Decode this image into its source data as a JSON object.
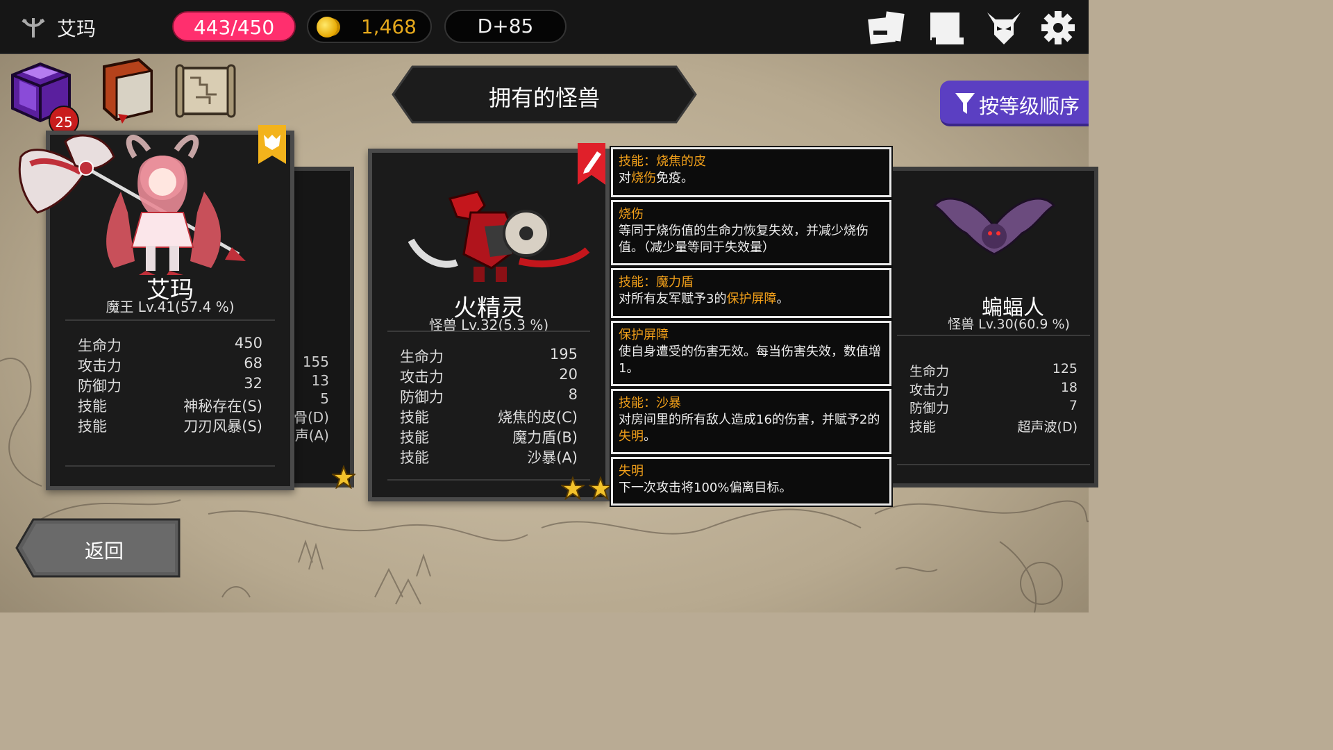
{
  "player": {
    "name": "艾玛",
    "hp": "443/450",
    "gold": "1,468",
    "day": "D+85"
  },
  "top_icons": [
    "cards-icon",
    "scroll-icon",
    "demon-mask-icon",
    "gear-icon"
  ],
  "items": {
    "chest_badge": "25"
  },
  "title": "拥有的怪兽",
  "sort_button": "按等级顺序",
  "back_button": "返回",
  "colors": {
    "hp": "#ff2f6e",
    "gold": "#e6a91c",
    "sort": "#5b3fc2",
    "highlight": "#f2a01a"
  },
  "cards": [
    {
      "name": "艾玛",
      "subtitle": "魔王 Lv.41(57.4 %)",
      "stats": [
        {
          "k": "生命力",
          "v": "450"
        },
        {
          "k": "攻击力",
          "v": "68"
        },
        {
          "k": "防御力",
          "v": "32"
        },
        {
          "k": "技能",
          "v": "神秘存在(S)"
        },
        {
          "k": "技能",
          "v": "刀刃风暴(S)"
        }
      ]
    },
    {
      "name": "火精灵",
      "subtitle": "怪兽 Lv.32(5.3 %)",
      "stats": [
        {
          "k": "生命力",
          "v": "195"
        },
        {
          "k": "攻击力",
          "v": "20"
        },
        {
          "k": "防御力",
          "v": "8"
        },
        {
          "k": "技能",
          "v": "烧焦的皮(C)"
        },
        {
          "k": "技能",
          "v": "魔力盾(B)"
        },
        {
          "k": "技能",
          "v": "沙暴(A)"
        }
      ],
      "stars": 2
    },
    {
      "name": "蝙蝠人",
      "subtitle": "怪兽 Lv.30(60.9 %)",
      "stats": [
        {
          "k": "生命力",
          "v": "125"
        },
        {
          "k": "攻击力",
          "v": "18"
        },
        {
          "k": "防御力",
          "v": "7"
        },
        {
          "k": "技能",
          "v": "超声波(D)"
        }
      ]
    }
  ],
  "partial_card": {
    "values": [
      "155",
      "13",
      "5",
      "骨(D)",
      "声(A)"
    ]
  },
  "tooltips": [
    {
      "head": "技能：烧焦的皮",
      "body_pre": "对",
      "body_hl": "烧伤",
      "body_post": "免疫。"
    },
    {
      "head": "烧伤",
      "body": "等同于烧伤值的生命力恢复失效，并减少烧伤值。（减少量等同于失效量）"
    },
    {
      "head": "技能：魔力盾",
      "body_pre": "对所有友军赋予3的",
      "body_hl": "保护屏障",
      "body_post": "。"
    },
    {
      "head": "保护屏障",
      "body": "使自身遭受的伤害无效。每当伤害失效，数值增1。"
    },
    {
      "head": "技能：沙暴",
      "body_pre": "对房间里的所有敌人造成16的伤害，并赋予2的",
      "body_hl": "失明",
      "body_post": "。"
    },
    {
      "head": "失明",
      "body": "下一次攻击将100%偏离目标。"
    }
  ]
}
